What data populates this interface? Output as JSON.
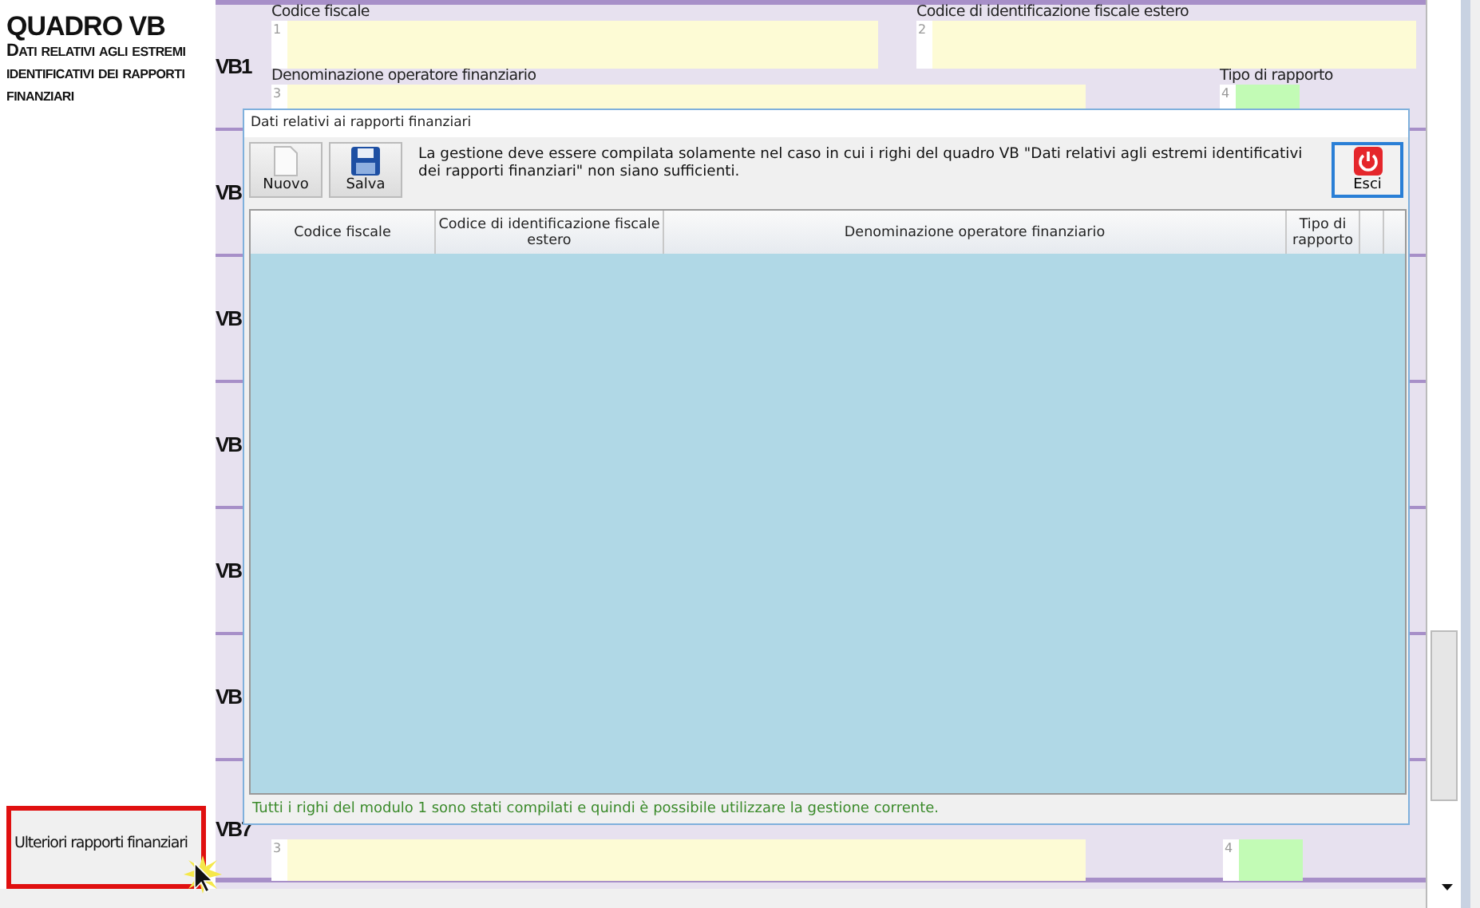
{
  "sheet": {
    "title": "QUADRO VB",
    "subtitle": "Dati relativi agli estremi identificativi dei rapporti finanziari",
    "side_button": "Ulteriori rapporti finanziari"
  },
  "rows": [
    {
      "kind": "full",
      "label": "VB1",
      "fields": [
        {
          "number": "1",
          "label": "Codice fiscale"
        },
        {
          "number": "2",
          "label": "Codice di identificazione fiscale estero"
        },
        {
          "number": "3",
          "label": "Denominazione operatore finanziario"
        },
        {
          "number": "4",
          "label": "Tipo di rapporto"
        }
      ]
    },
    {
      "kind": "covered",
      "label": "VB"
    },
    {
      "kind": "covered",
      "label": "VB"
    },
    {
      "kind": "covered",
      "label": "VB"
    },
    {
      "kind": "covered",
      "label": "VB"
    },
    {
      "kind": "covered",
      "label": "VB"
    },
    {
      "kind": "bottom",
      "label": "VB7",
      "fields": [
        {
          "number": "3"
        },
        {
          "number": "4"
        }
      ]
    }
  ],
  "dialog": {
    "title": "Dati relativi ai rapporti finanziari",
    "buttons": [
      {
        "label": "Nuovo",
        "kind": "new"
      },
      {
        "label": "Salva",
        "kind": "save"
      }
    ],
    "message": "La gestione deve essere compilata solamente nel caso in cui i righi del quadro VB \"Dati relativi agli estremi identificativi dei rapporti finanziari\" non siano sufficienti.",
    "exit_button": "Esci",
    "columns": [
      "Codice fiscale",
      "Codice di identificazione fiscale estero",
      "Denominazione operatore finanziario",
      "Tipo di rapporto"
    ],
    "footer": "Tutti i righi del modulo 1 sono stati compilati e quindi è possibile utilizzare la gestione corrente."
  }
}
